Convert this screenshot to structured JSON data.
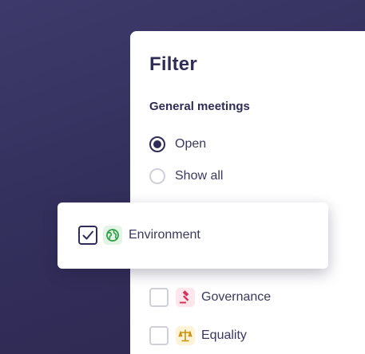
{
  "filter": {
    "title": "Filter",
    "section_label": "General meetings",
    "options": [
      {
        "label": "Open",
        "selected": true
      },
      {
        "label": "Show all",
        "selected": false
      }
    ],
    "categories": [
      {
        "label": "Environment",
        "checked": true,
        "icon": "earth-icon",
        "icon_color": "#2f9e44",
        "icon_bg": "#e3f5e6"
      },
      {
        "label": "Governance",
        "checked": false,
        "icon": "gavel-icon",
        "icon_color": "#d6335a",
        "icon_bg": "#fde6ec"
      },
      {
        "label": "Equality",
        "checked": false,
        "icon": "scales-icon",
        "icon_color": "#c9910a",
        "icon_bg": "#fdf3d9"
      }
    ]
  },
  "colors": {
    "accent": "#2f2c57",
    "background": "#34305d"
  }
}
